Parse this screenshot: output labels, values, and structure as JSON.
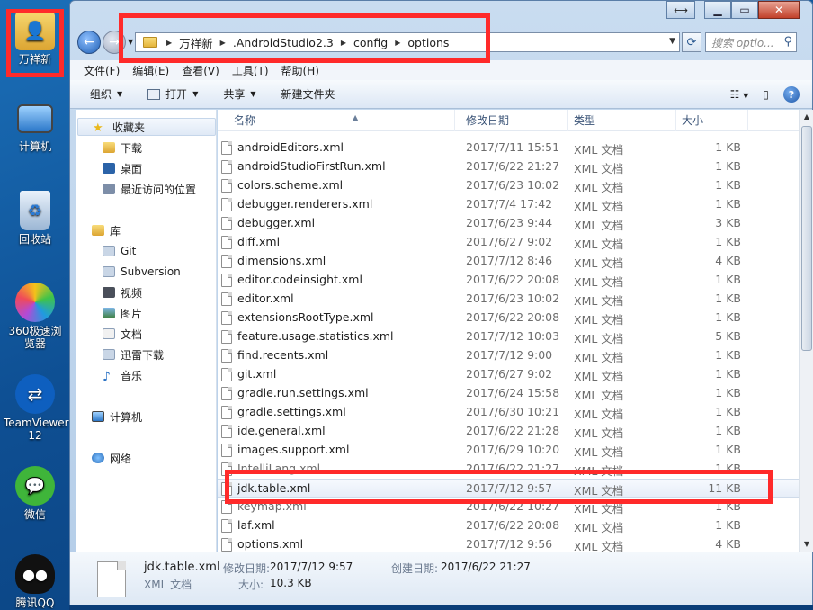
{
  "desktop": {
    "icons": [
      {
        "label": "万祥新"
      },
      {
        "label": "计算机"
      },
      {
        "label": "回收站"
      },
      {
        "label": "360极速浏览器"
      },
      {
        "label": "TeamViewer 12"
      },
      {
        "label": "微信"
      },
      {
        "label": "腾讯QQ"
      }
    ]
  },
  "window": {
    "address": {
      "crumbs": [
        "万祥新",
        ".AndroidStudio2.3",
        "config",
        "options"
      ]
    },
    "search_placeholder": "搜索 optio...",
    "menu": [
      "文件(F)",
      "编辑(E)",
      "查看(V)",
      "工具(T)",
      "帮助(H)"
    ],
    "toolbar": {
      "organize": "组织",
      "open": "打开",
      "share": "共享",
      "new_folder": "新建文件夹"
    },
    "navpane": {
      "favorites": "收藏夹",
      "fav_items": [
        "下载",
        "桌面",
        "最近访问的位置"
      ],
      "libraries": "库",
      "lib_items": [
        "Git",
        "Subversion",
        "视频",
        "图片",
        "文档",
        "迅雷下载",
        "音乐"
      ],
      "computer": "计算机",
      "network": "网络"
    },
    "columns": {
      "name": "名称",
      "date": "修改日期",
      "type": "类型",
      "size": "大小"
    },
    "files": [
      {
        "name": "androidEditors.xml",
        "date": "2017/7/11 15:51",
        "type": "XML 文档",
        "size": "1 KB"
      },
      {
        "name": "androidStudioFirstRun.xml",
        "date": "2017/6/22 21:27",
        "type": "XML 文档",
        "size": "1 KB"
      },
      {
        "name": "colors.scheme.xml",
        "date": "2017/6/23 10:02",
        "type": "XML 文档",
        "size": "1 KB"
      },
      {
        "name": "debugger.renderers.xml",
        "date": "2017/7/4 17:42",
        "type": "XML 文档",
        "size": "1 KB"
      },
      {
        "name": "debugger.xml",
        "date": "2017/6/23 9:44",
        "type": "XML 文档",
        "size": "3 KB"
      },
      {
        "name": "diff.xml",
        "date": "2017/6/27 9:02",
        "type": "XML 文档",
        "size": "1 KB"
      },
      {
        "name": "dimensions.xml",
        "date": "2017/7/12 8:46",
        "type": "XML 文档",
        "size": "4 KB"
      },
      {
        "name": "editor.codeinsight.xml",
        "date": "2017/6/22 20:08",
        "type": "XML 文档",
        "size": "1 KB"
      },
      {
        "name": "editor.xml",
        "date": "2017/6/23 10:02",
        "type": "XML 文档",
        "size": "1 KB"
      },
      {
        "name": "extensionsRootType.xml",
        "date": "2017/6/22 20:08",
        "type": "XML 文档",
        "size": "1 KB"
      },
      {
        "name": "feature.usage.statistics.xml",
        "date": "2017/7/12 10:03",
        "type": "XML 文档",
        "size": "5 KB"
      },
      {
        "name": "find.recents.xml",
        "date": "2017/7/12 9:00",
        "type": "XML 文档",
        "size": "1 KB"
      },
      {
        "name": "git.xml",
        "date": "2017/6/27 9:02",
        "type": "XML 文档",
        "size": "1 KB"
      },
      {
        "name": "gradle.run.settings.xml",
        "date": "2017/6/24 15:58",
        "type": "XML 文档",
        "size": "1 KB"
      },
      {
        "name": "gradle.settings.xml",
        "date": "2017/6/30 10:21",
        "type": "XML 文档",
        "size": "1 KB"
      },
      {
        "name": "ide.general.xml",
        "date": "2017/6/22 21:28",
        "type": "XML 文档",
        "size": "1 KB"
      },
      {
        "name": "images.support.xml",
        "date": "2017/6/29 10:20",
        "type": "XML 文档",
        "size": "1 KB"
      },
      {
        "name": "IntelliLang.xml",
        "date": "2017/6/22 21:27",
        "type": "XML 文档",
        "size": "1 KB"
      },
      {
        "name": "jdk.table.xml",
        "date": "2017/7/12 9:57",
        "type": "XML 文档",
        "size": "11 KB"
      },
      {
        "name": "keymap.xml",
        "date": "2017/6/22 10:27",
        "type": "XML 文档",
        "size": "1 KB"
      },
      {
        "name": "laf.xml",
        "date": "2017/6/22 20:08",
        "type": "XML 文档",
        "size": "1 KB"
      },
      {
        "name": "options.xml",
        "date": "2017/7/12 9:56",
        "type": "XML 文档",
        "size": "4 KB"
      }
    ],
    "details": {
      "filename": "jdk.table.xml",
      "filetype": "XML 文档",
      "modified_label": "修改日期:",
      "modified": "2017/7/12 9:57",
      "created_label": "创建日期:",
      "created": "2017/6/22 21:27",
      "size_label": "大小:",
      "size": "10.3 KB"
    }
  },
  "colors": {
    "highlight_box": "#ff2a2a",
    "selection": "#e7eef8",
    "desktop": "#1b6fb8"
  }
}
